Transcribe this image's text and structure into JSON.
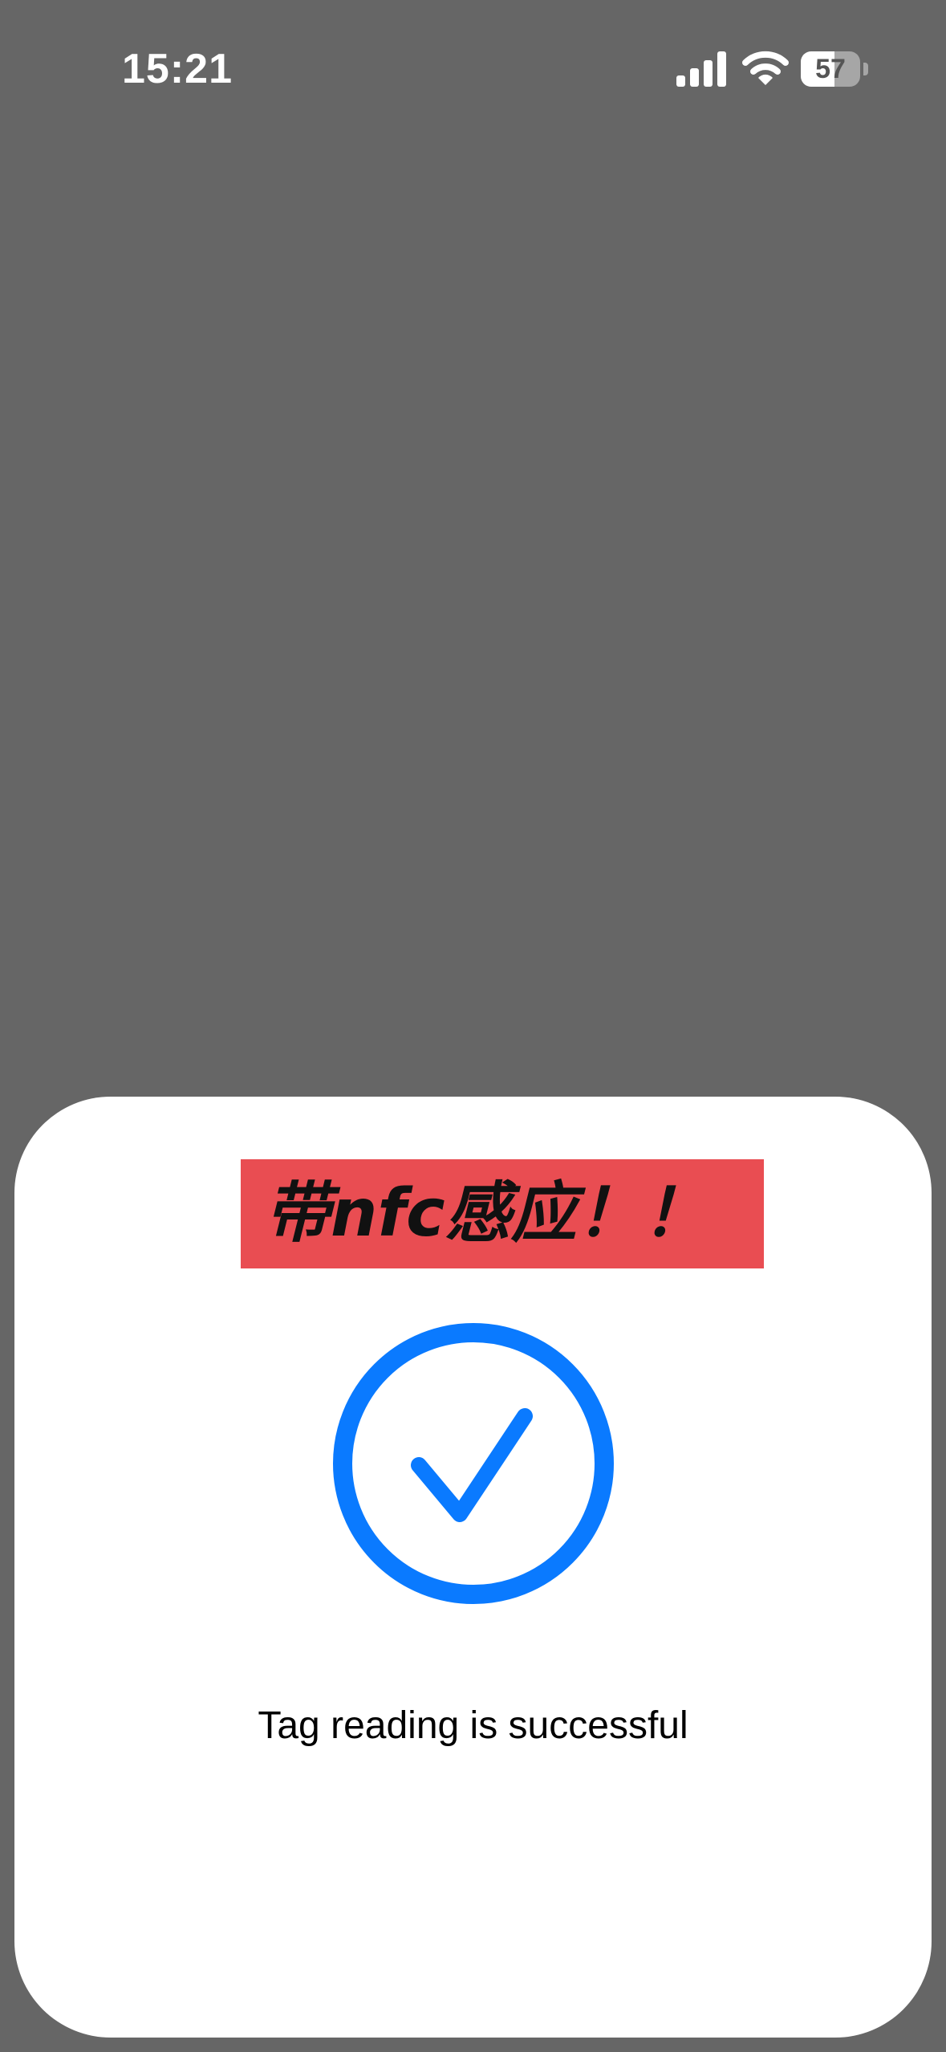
{
  "status_bar": {
    "time": "15:21",
    "signal_icon": "cellular-signal-icon",
    "wifi_icon": "wifi-icon",
    "battery_icon": "battery-icon",
    "battery_level": "57",
    "battery_fraction": 0.57
  },
  "nfc_sheet": {
    "banner_text": "带nfc感应！！",
    "success_icon": "checkmark-circle-icon",
    "message": "Tag reading is successful"
  },
  "colors": {
    "background_dim": "#666666",
    "sheet": "#ffffff",
    "accent_blue": "#0A7AFF",
    "banner_red": "#E94D52"
  }
}
